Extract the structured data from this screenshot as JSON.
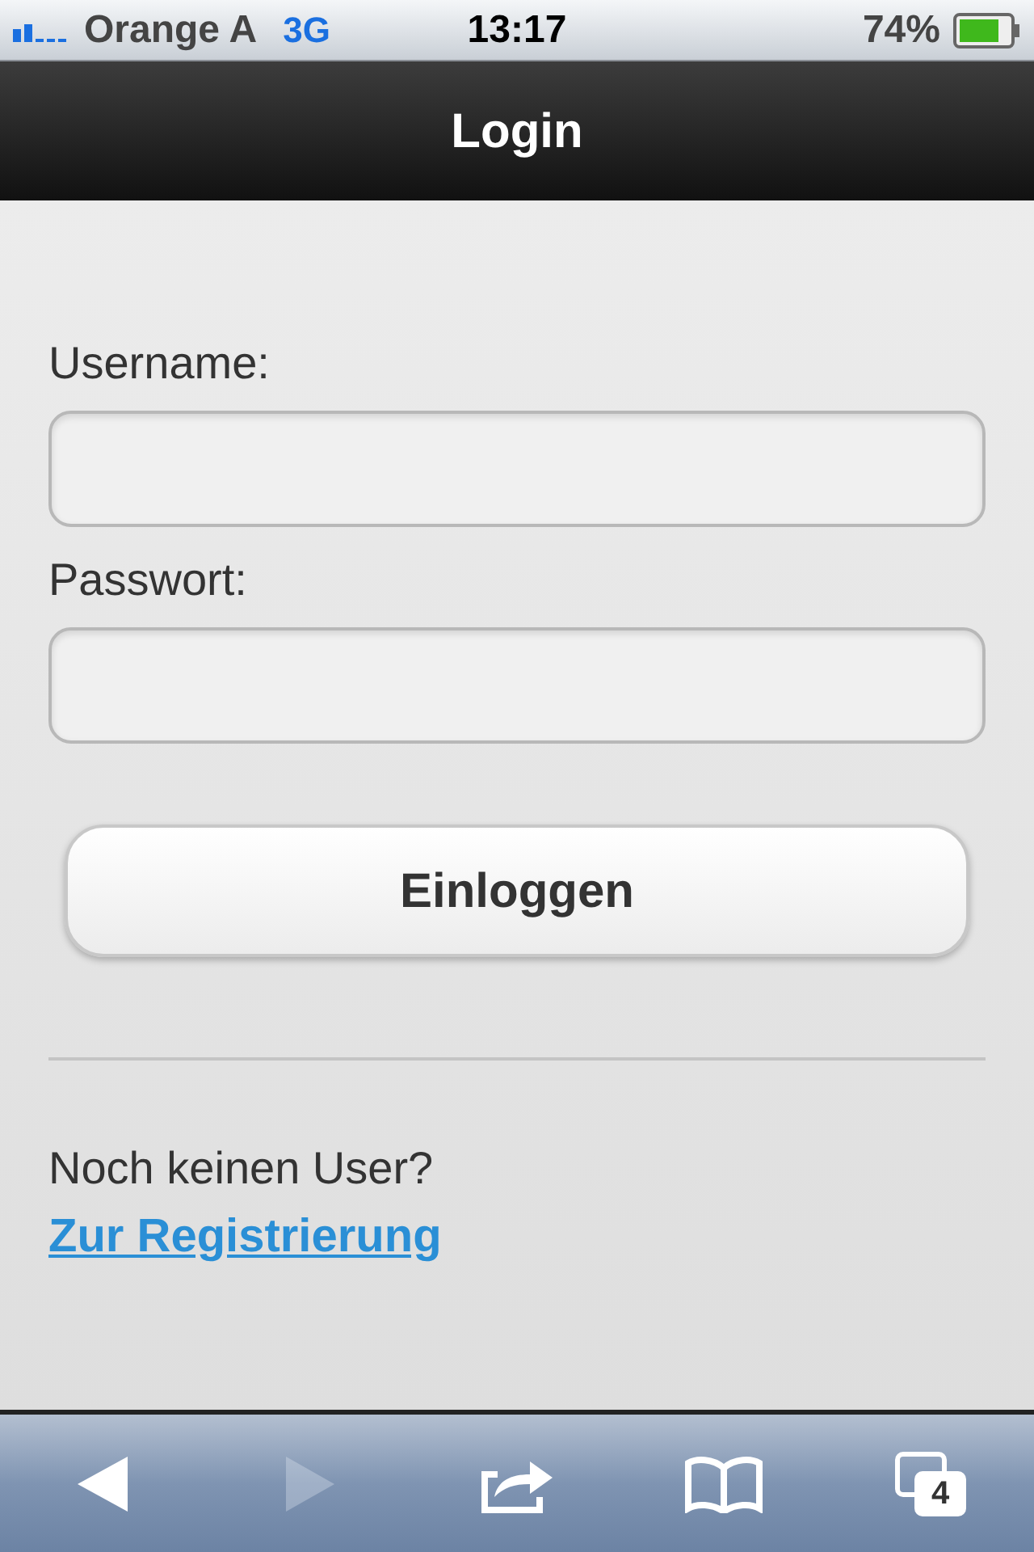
{
  "status_bar": {
    "carrier": "Orange A",
    "network": "3G",
    "time": "13:17",
    "battery": "74%"
  },
  "header": {
    "title": "Login"
  },
  "form": {
    "fields": [
      {
        "label": "Username:"
      },
      {
        "label": "Passwort:"
      }
    ],
    "submit": "Einloggen"
  },
  "register": {
    "text": "Noch keinen User?",
    "link": "Zur Registrierung"
  },
  "toolbar": [
    {
      "kind": "back",
      "disabled": false
    },
    {
      "kind": "forward",
      "disabled": true
    },
    {
      "kind": "share",
      "disabled": false
    },
    {
      "kind": "bookmarks",
      "disabled": false
    },
    {
      "kind": "tabs",
      "disabled": false,
      "count": "4"
    }
  ]
}
